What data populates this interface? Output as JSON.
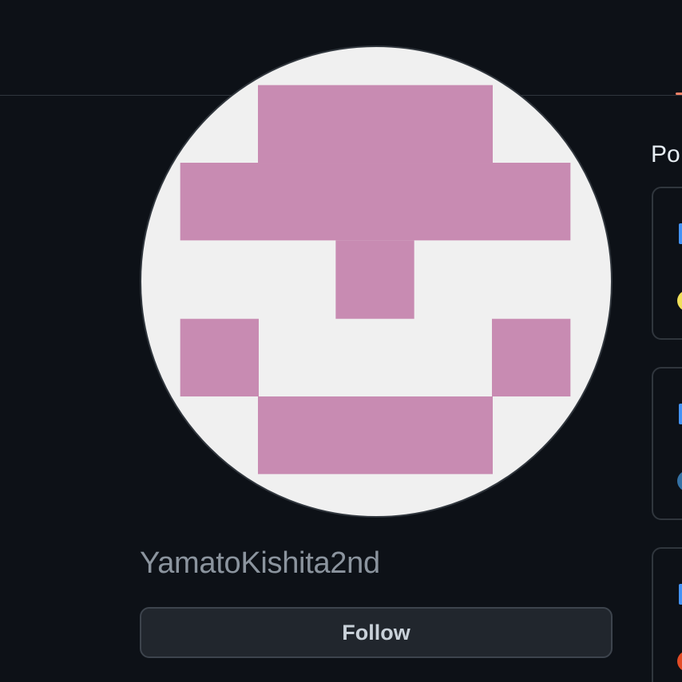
{
  "profile": {
    "username": "YamatoKishita2nd",
    "follow_label": "Follow",
    "avatar_fg_color": "#c88bb2",
    "avatar_bg_color": "#f0f0f0"
  },
  "pinned": {
    "heading": "Po",
    "cards": [
      {
        "lang_color": "#f1e05a"
      },
      {
        "lang_color": "#3572a5"
      },
      {
        "lang_color": "#e34c26"
      }
    ]
  },
  "colors": {
    "page_bg": "#0d1117",
    "border": "#30363d",
    "link": "#4493f8",
    "tab_accent": "#f78166"
  }
}
